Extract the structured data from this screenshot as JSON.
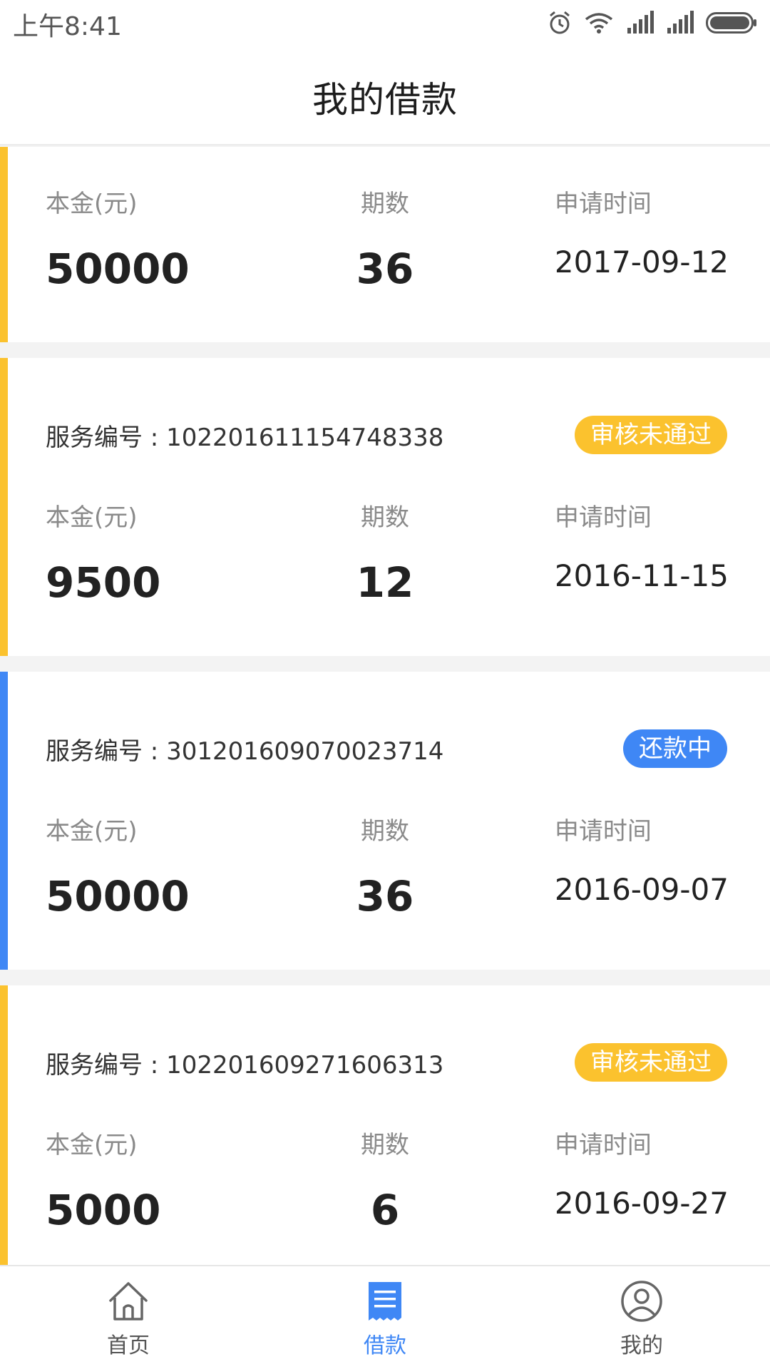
{
  "status_bar": {
    "time": "上午8:41",
    "icons": [
      "alarm-icon",
      "wifi-icon",
      "signal-icon",
      "signal-icon",
      "battery-icon"
    ]
  },
  "header": {
    "title": "我的借款"
  },
  "colors": {
    "pending": "#fbc22e",
    "active": "#3f87f5"
  },
  "labels": {
    "principal": "本金(元)",
    "periods": "期数",
    "apply_time": "申请时间"
  },
  "loans": [
    {
      "service_no": "",
      "status": "",
      "status_color": "#fbc22e",
      "principal": "50000",
      "periods": "36",
      "apply_time": "2017-09-12"
    },
    {
      "service_no": "服务编号 : 102201611154748338",
      "status": "审核未通过",
      "status_color": "#fbc22e",
      "principal": "9500",
      "periods": "12",
      "apply_time": "2016-11-15"
    },
    {
      "service_no": "服务编号 : 301201609070023714",
      "status": "还款中",
      "status_color": "#3f87f5",
      "principal": "50000",
      "periods": "36",
      "apply_time": "2016-09-07"
    },
    {
      "service_no": "服务编号 : 102201609271606313",
      "status": "审核未通过",
      "status_color": "#fbc22e",
      "principal": "5000",
      "periods": "6",
      "apply_time": "2016-09-27"
    }
  ],
  "tabbar": {
    "items": [
      {
        "label": "首页",
        "icon": "home-icon",
        "active": false
      },
      {
        "label": "借款",
        "icon": "document-icon",
        "active": true
      },
      {
        "label": "我的",
        "icon": "user-icon",
        "active": false
      }
    ]
  }
}
